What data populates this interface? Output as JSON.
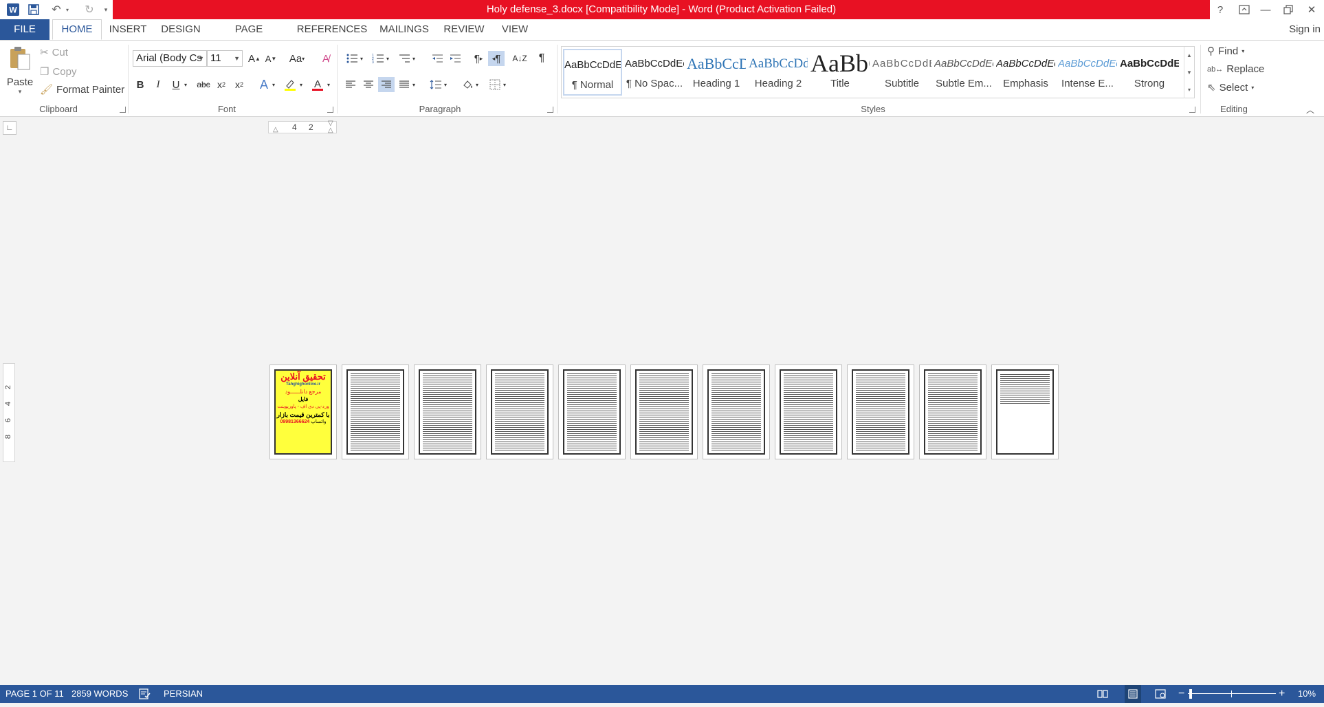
{
  "title_bar": {
    "title": "Holy defense_3.docx [Compatibility Mode] - Word (Product Activation Failed)",
    "help": "?",
    "colors": {
      "bar": "#e81123",
      "accent": "#2b579a"
    }
  },
  "tabs": {
    "file": "FILE",
    "home": "HOME",
    "insert": "INSERT",
    "design": "DESIGN",
    "page_layout": "PAGE LAYOUT",
    "references": "REFERENCES",
    "mailings": "MAILINGS",
    "review": "REVIEW",
    "view": "VIEW",
    "sign_in": "Sign in"
  },
  "clipboard": {
    "paste": "Paste",
    "cut": "Cut",
    "copy": "Copy",
    "format_painter": "Format Painter",
    "group_label": "Clipboard"
  },
  "font": {
    "font_name": "Arial (Body Cs",
    "font_size": "11",
    "change_case": "Aa",
    "group_label": "Font"
  },
  "paragraph": {
    "group_label": "Paragraph"
  },
  "styles": {
    "group_label": "Styles",
    "items": [
      {
        "sample": "AaBbCcDdEe",
        "name": "¶ Normal"
      },
      {
        "sample": "AaBbCcDdEe",
        "name": "¶ No Spac..."
      },
      {
        "sample": "AaBbCcDdEe",
        "name": "Heading 1"
      },
      {
        "sample": "AaBbCcDdEe",
        "name": "Heading 2"
      },
      {
        "sample": "AaBbCcDdEe",
        "name": "Title"
      },
      {
        "sample": "AaBbCcDdEe",
        "name": "Subtitle"
      },
      {
        "sample": "AaBbCcDdEe",
        "name": "Subtle Em..."
      },
      {
        "sample": "AaBbCcDdEe",
        "name": "Emphasis"
      },
      {
        "sample": "AaBbCcDdEe",
        "name": "Intense E..."
      },
      {
        "sample": "AaBbCcDdEe",
        "name": "Strong"
      }
    ]
  },
  "editing": {
    "find": "Find",
    "replace": "Replace",
    "select": "Select",
    "group_label": "Editing"
  },
  "ruler": {
    "h_ticks": [
      "4",
      "2"
    ],
    "v_ticks": [
      "2",
      "4",
      "6",
      "8"
    ]
  },
  "pages": {
    "count": 11,
    "ad_page": {
      "title": "تحقیق آنلاین",
      "site": "Tahghighonline.ir",
      "line1": "مرجع دانلــــــود",
      "line2": "فایل",
      "line3": "ورد-پی دی اف - پاورپوینت",
      "line4": "با کمترین قیمت بازار",
      "phone": "09981366624",
      "whatsapp": "واتساپ"
    }
  },
  "status": {
    "page": "PAGE 1 OF 11",
    "words": "2859 WORDS",
    "language": "PERSIAN",
    "zoom": "10%"
  }
}
